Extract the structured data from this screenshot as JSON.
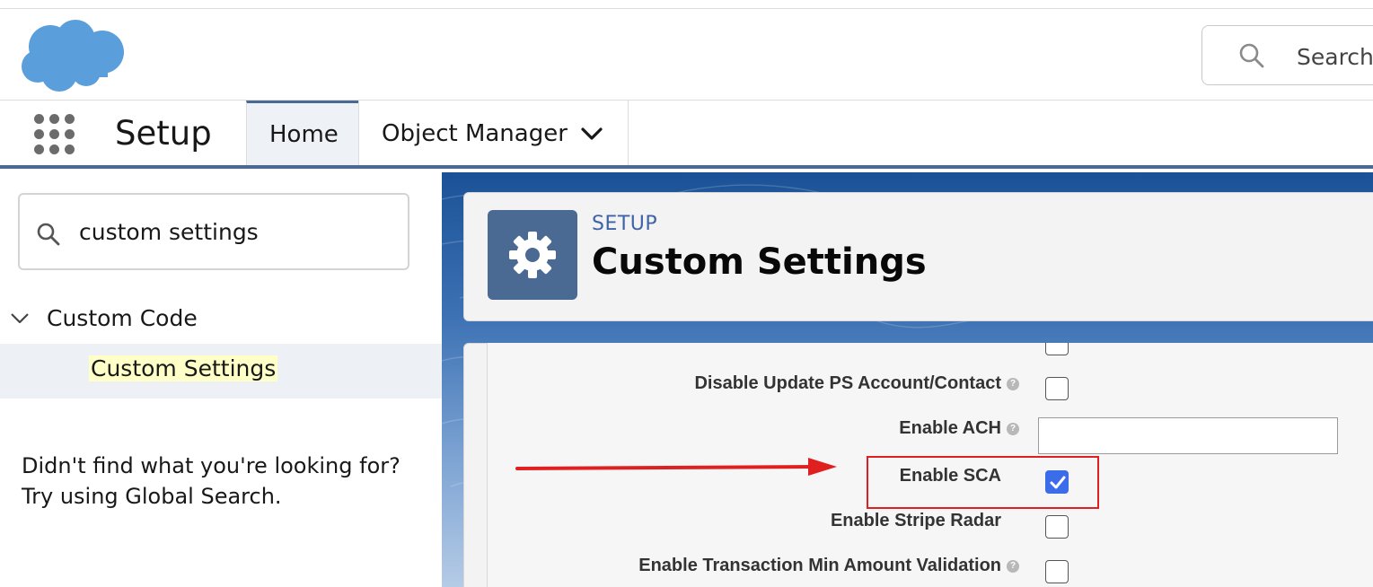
{
  "header": {
    "global_search_placeholder": "Search"
  },
  "nav": {
    "app_name": "Setup",
    "tabs": [
      {
        "label": "Home",
        "active": true
      },
      {
        "label": "Object Manager",
        "has_dropdown": true
      }
    ]
  },
  "sidebar": {
    "quick_find_value": "custom settings",
    "section_label": "Custom Code",
    "selected_item": "Custom Settings",
    "help_line1": "Didn't find what you're looking for?",
    "help_line2": "Try using Global Search."
  },
  "page": {
    "eyebrow": "SETUP",
    "title": "Custom Settings"
  },
  "form": {
    "fields": [
      {
        "label": "Disable Update PS Account/Contact",
        "type": "checkbox",
        "checked": false,
        "has_help": true
      },
      {
        "label": "Enable ACH",
        "type": "text",
        "value": "",
        "has_help": true
      },
      {
        "label": "Enable SCA",
        "type": "checkbox",
        "checked": true,
        "has_help": false
      },
      {
        "label": "Enable Stripe Radar",
        "type": "checkbox",
        "checked": false,
        "has_help": false
      },
      {
        "label": "Enable Transaction Min Amount Validation",
        "type": "checkbox",
        "checked": false,
        "has_help": true
      }
    ]
  },
  "colors": {
    "brand_blue": "#4a6a93",
    "checkbox_checked": "#3b6cea",
    "annotation_red": "#e02020"
  }
}
